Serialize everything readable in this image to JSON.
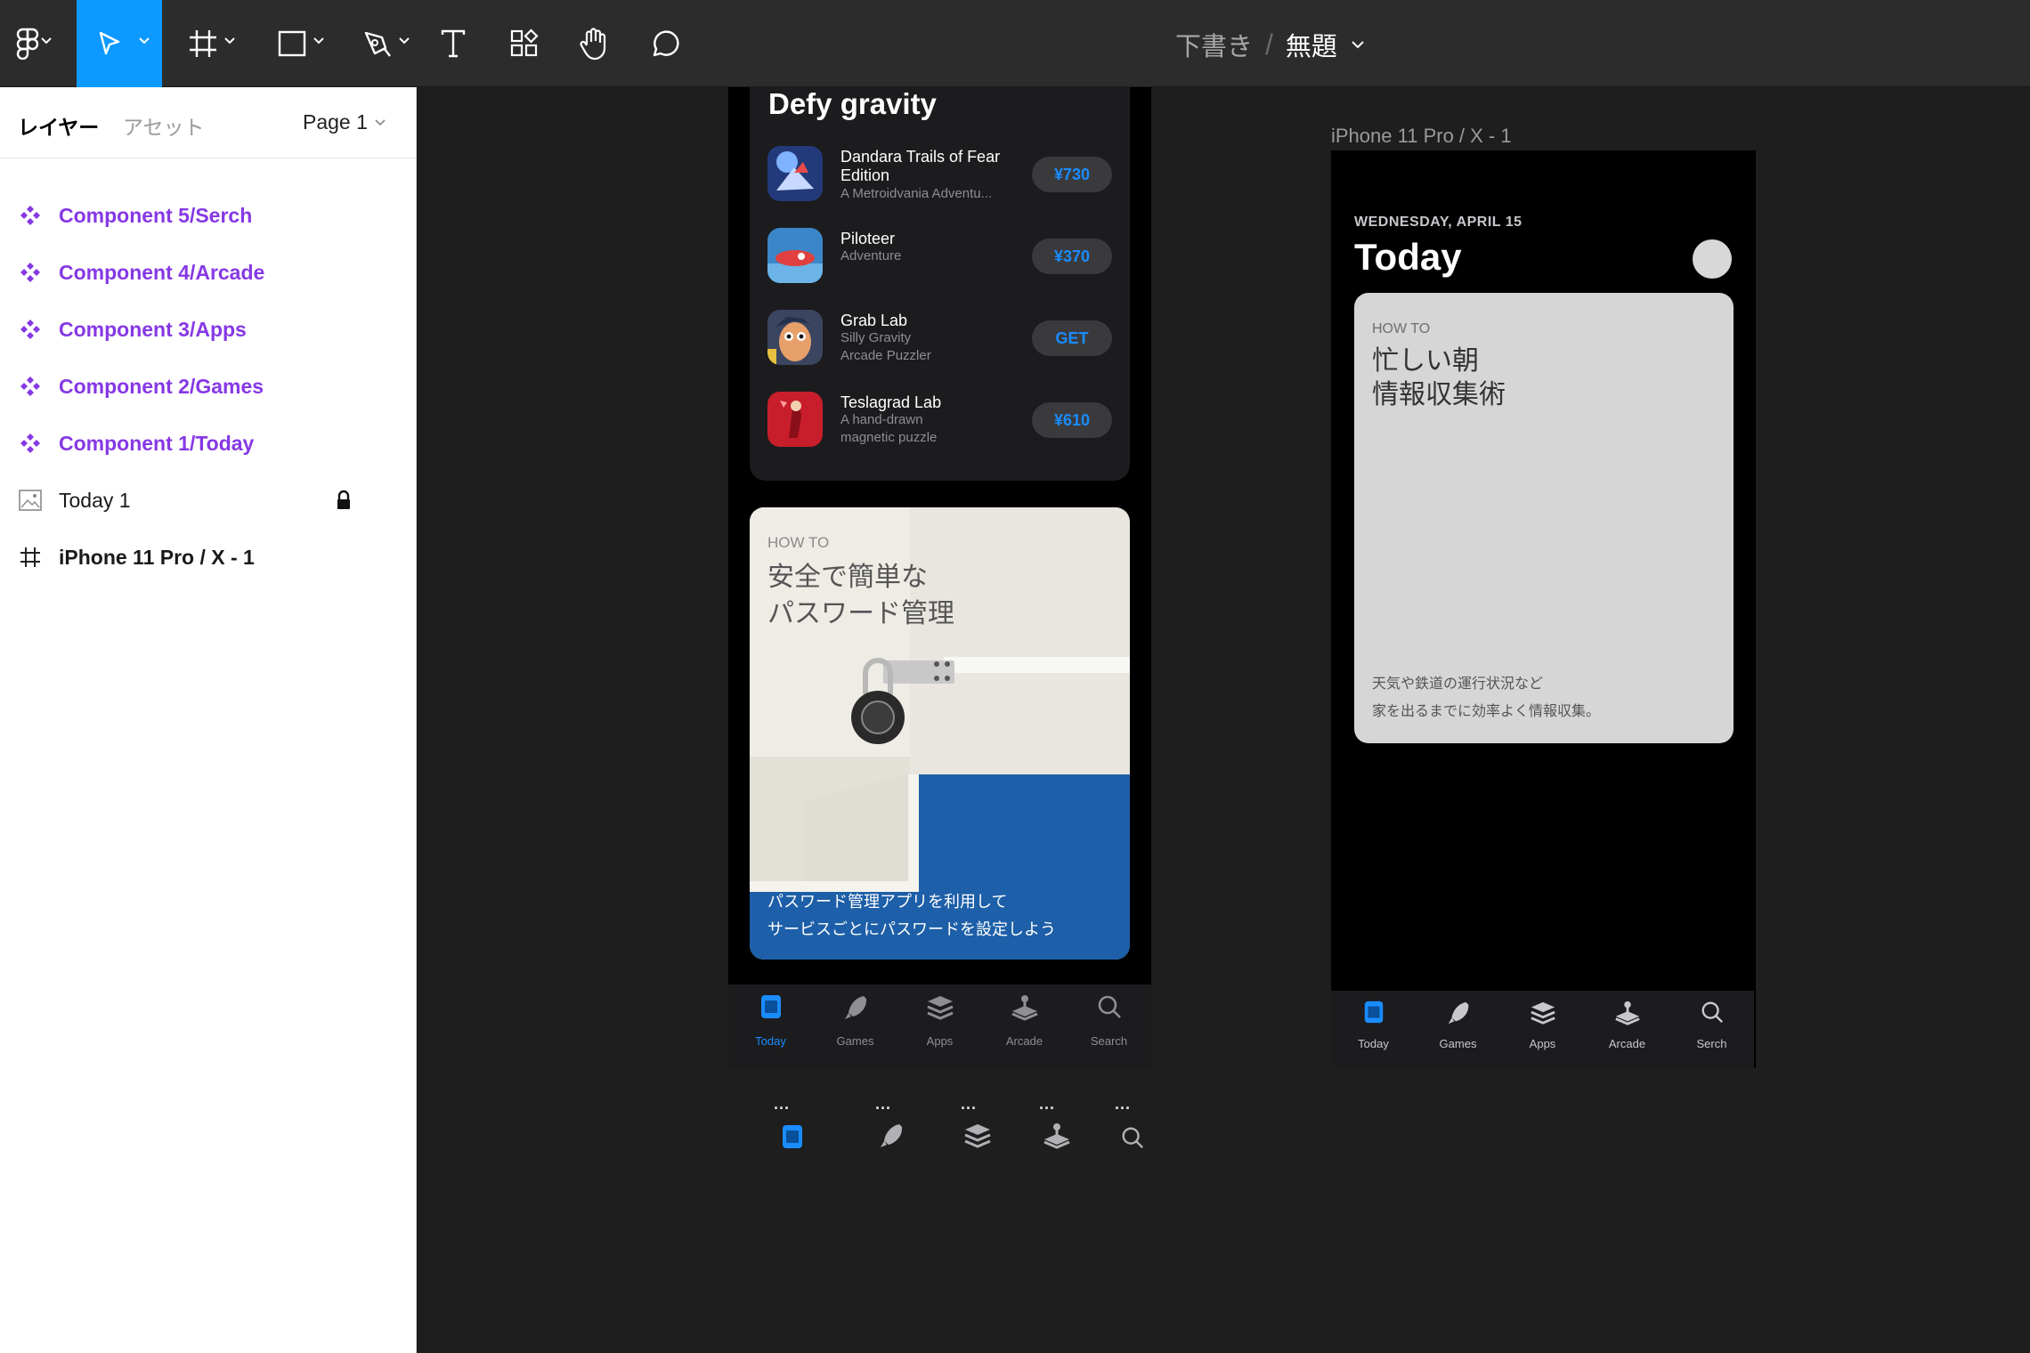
{
  "toolbar": {
    "doc_folder": "下書き",
    "separator": "/",
    "doc_name": "無題"
  },
  "left_panel": {
    "tabs": {
      "layers": "レイヤー",
      "assets": "アセット"
    },
    "page": "Page 1",
    "layers": [
      {
        "name": "Component 5/Serch",
        "kind": "component"
      },
      {
        "name": "Component 4/Arcade",
        "kind": "component"
      },
      {
        "name": "Component 3/Apps",
        "kind": "component"
      },
      {
        "name": "Component 2/Games",
        "kind": "component"
      },
      {
        "name": "Component 1/Today",
        "kind": "component"
      },
      {
        "name": "Today 1",
        "kind": "image",
        "locked": true
      },
      {
        "name": "iPhone 11 Pro / X - 1",
        "kind": "frame"
      }
    ]
  },
  "left_phone": {
    "section_title": "Defy gravity",
    "apps": [
      {
        "name": "Dandara Trails of Fear Edition",
        "name_line1": "Dandara Trails of Fear",
        "name_line2": "Edition",
        "sub1": "A Metroidvania Adventu...",
        "sub2": "",
        "button": "¥730"
      },
      {
        "name_line1": "Piloteer",
        "name_line2": "",
        "sub1": "Adventure",
        "sub2": "",
        "button": "¥370"
      },
      {
        "name_line1": "Grab Lab",
        "name_line2": "",
        "sub1": "Silly Gravity",
        "sub2": "Arcade Puzzler",
        "button": "GET"
      },
      {
        "name_line1": "Teslagrad Lab",
        "name_line2": "",
        "sub1": "A hand-drawn",
        "sub2": "magnetic puzzle",
        "button": "¥610"
      }
    ],
    "howto_card": {
      "kicker": "HOW TO",
      "title": "安全で簡単な\nパスワード管理",
      "caption": "パスワード管理アプリを利用して\nサービスごとにパスワードを設定しよう"
    },
    "tabs": [
      "Today",
      "Games",
      "Apps",
      "Arcade",
      "Search"
    ],
    "active_tab": "Today"
  },
  "floating_components": {
    "dots": "..."
  },
  "right_frame": {
    "label": "iPhone 11 Pro / X - 1",
    "date": "WEDNESDAY, APRIL 15",
    "title": "Today",
    "card": {
      "kicker": "HOW TO",
      "title": "忙しい朝\n情報収集術",
      "caption": "天気や鉄道の運行状況など\n家を出るまでに効率よく情報収集。"
    },
    "tabs": [
      "Today",
      "Games",
      "Apps",
      "Arcade",
      "Serch"
    ]
  },
  "colors": {
    "accent": "#0d99ff",
    "component_purple": "#8638e5",
    "ios_blue": "#1a8cff"
  }
}
